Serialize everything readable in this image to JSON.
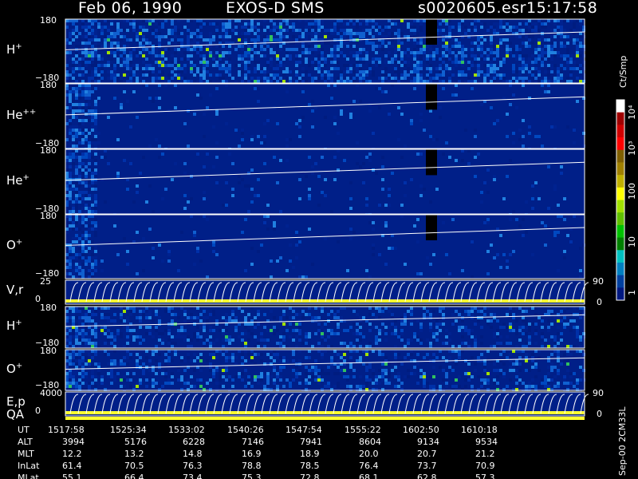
{
  "header": {
    "date": "Feb 06, 1990",
    "instrument": "EXOS-D SMS",
    "file": "s0020605.esr",
    "time": "15:17:58"
  },
  "colorbar": {
    "label": "Ct/Smp",
    "ticks": [
      "10⁴",
      "10³",
      "100",
      "10",
      "1"
    ],
    "colors": [
      "#ffffff",
      "#a00000",
      "#d00000",
      "#ff0000",
      "#806000",
      "#a08000",
      "#c0b000",
      "#ffff00",
      "#a0e000",
      "#60c000",
      "#00c000",
      "#008000",
      "#00c0c0",
      "#0080c0",
      "#0040a0",
      "#001880"
    ]
  },
  "panels": [
    {
      "id": "h-plus-pitch",
      "label": "H",
      "sup": "+",
      "tick_top": "180",
      "tick_bottom": "−180",
      "texture": "high"
    },
    {
      "id": "he-plus-plus-pitch",
      "label": "He",
      "sup": "++",
      "tick_top": "180",
      "tick_bottom": "−180",
      "texture": "low"
    },
    {
      "id": "he-plus-pitch",
      "label": "He",
      "sup": "+",
      "tick_top": "180",
      "tick_bottom": "−180",
      "texture": "low"
    },
    {
      "id": "o-plus-pitch",
      "label": "O",
      "sup": "+",
      "tick_top": "180",
      "tick_bottom": "−180",
      "texture": "low"
    },
    {
      "id": "vr-panel",
      "label": "V,r",
      "sup": "",
      "tick_top": "25",
      "tick_bottom": "0",
      "right_top": "90",
      "right_bottom": "0",
      "texture": "line"
    },
    {
      "id": "h-plus-energy",
      "label": "H",
      "sup": "+",
      "tick_top": "180",
      "tick_bottom": "−180",
      "texture": "mid"
    },
    {
      "id": "o-plus-energy",
      "label": "O",
      "sup": "+",
      "tick_top": "180",
      "tick_bottom": "−180",
      "texture": "mid"
    },
    {
      "id": "ep-panel",
      "label": "E,p",
      "sup": "",
      "tick_top": "4000",
      "tick_bottom": "0",
      "right_top": "90",
      "right_bottom": "0",
      "texture": "line"
    }
  ],
  "qa_label": "QA",
  "footer": {
    "row_labels": [
      "UT",
      "ALT",
      "MLT",
      "InLat",
      "MLat"
    ],
    "columns": [
      [
        "1517:58",
        "3994",
        "12.2",
        "61.4",
        "55.1"
      ],
      [
        "1525:34",
        "5176",
        "13.2",
        "70.5",
        "66.4"
      ],
      [
        "1533:02",
        "6228",
        "14.8",
        "76.3",
        "73.4"
      ],
      [
        "1540:26",
        "7146",
        "16.9",
        "78.8",
        "75.3"
      ],
      [
        "1547:54",
        "7941",
        "18.9",
        "78.5",
        "72.8"
      ],
      [
        "1555:22",
        "8604",
        "20.0",
        "76.4",
        "68.1"
      ],
      [
        "1602:50",
        "9134",
        "20.7",
        "73.7",
        "62.8"
      ],
      [
        "1610:18",
        "9534",
        "21.2",
        "70.9",
        "57.3"
      ]
    ],
    "version": "Sep-00 2CM33L"
  },
  "chart_data": {
    "type": "heatmap",
    "title": "Feb 06, 1990   EXOS-D SMS",
    "x_ticks": [
      "1517:58",
      "1525:34",
      "1533:02",
      "1540:26",
      "1547:54",
      "1555:22",
      "1602:50",
      "1610:18"
    ],
    "panels": [
      "H+",
      "He++",
      "He+",
      "O+",
      "V,r",
      "H+",
      "O+",
      "E,p"
    ],
    "y_range_pitch": [
      -180,
      180
    ],
    "y_range_vr": [
      0,
      25
    ],
    "y_range_ep": [
      0,
      4000
    ],
    "colorbar_scale": "log",
    "colorbar_range": [
      1,
      10000
    ],
    "colorbar_unit": "Ct/Smp"
  }
}
